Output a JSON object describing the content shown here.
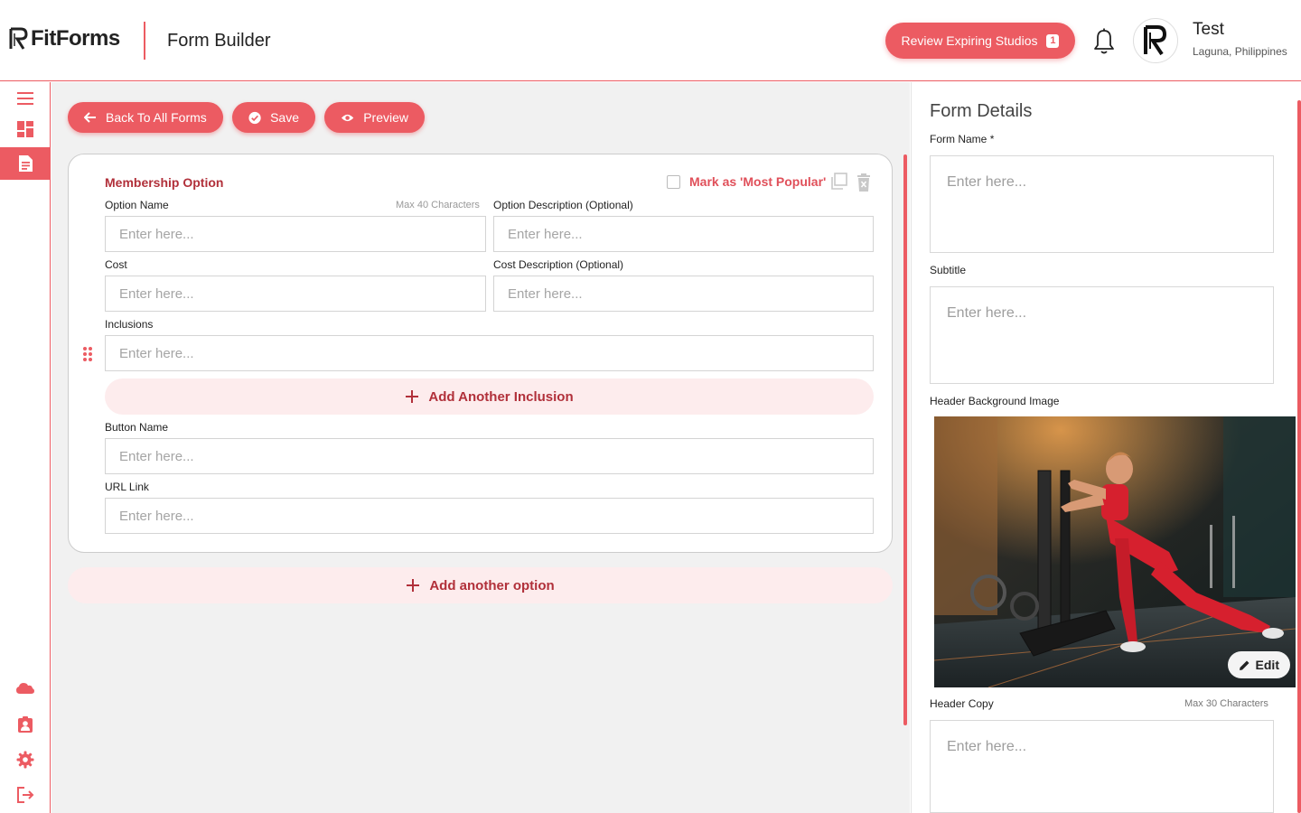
{
  "header": {
    "brand": "FitForms",
    "page_title": "Form Builder",
    "review_button": "Review Expiring Studios",
    "review_count": "1",
    "user_name": "Test",
    "user_location": "Laguna, Philippines"
  },
  "sidebar": {
    "items": [
      {
        "icon": "menu-icon",
        "active": false
      },
      {
        "icon": "dashboard-icon",
        "active": false
      },
      {
        "icon": "forms-icon",
        "active": true
      },
      {
        "icon": "cloud-icon",
        "active": false
      },
      {
        "icon": "contact-badge-icon",
        "active": false
      },
      {
        "icon": "settings-icon",
        "active": false
      },
      {
        "icon": "logout-icon",
        "active": false
      }
    ]
  },
  "toolbar": {
    "back_label": "Back To All Forms",
    "save_label": "Save",
    "preview_label": "Preview"
  },
  "option_card": {
    "title": "Membership Option",
    "most_popular_label": "Mark as 'Most Popular'",
    "most_popular_checked": false,
    "option_name_label": "Option Name",
    "option_name_hint": "Max 40 Characters",
    "option_name_placeholder": "Enter here...",
    "option_desc_label": "Option Description (Optional)",
    "option_desc_placeholder": "Enter here...",
    "cost_label": "Cost",
    "cost_placeholder": "Enter here...",
    "cost_desc_label": "Cost Description (Optional)",
    "cost_desc_placeholder": "Enter here...",
    "inclusions_label": "Inclusions",
    "inclusion_placeholder": "Enter here...",
    "add_inclusion_label": "Add Another Inclusion",
    "button_name_label": "Button Name",
    "button_name_placeholder": "Enter here...",
    "url_label": "URL Link",
    "url_placeholder": "Enter here..."
  },
  "add_option_label": "Add another option",
  "panel": {
    "title": "Form Details",
    "form_name_label": "Form Name",
    "required_mark": "*",
    "form_name_placeholder": "Enter here...",
    "subtitle_label": "Subtitle",
    "subtitle_placeholder": "Enter here...",
    "header_bg_label": "Header Background Image",
    "edit_label": "Edit",
    "header_copy_label": "Header Copy",
    "header_copy_hint": "Max 30 Characters",
    "header_copy_placeholder": "Enter here..."
  },
  "colors": {
    "accent": "#ec5b62",
    "accent_dark": "#b1303a",
    "accent_soft": "#fdeced",
    "main_bg": "#f1f1f1"
  }
}
